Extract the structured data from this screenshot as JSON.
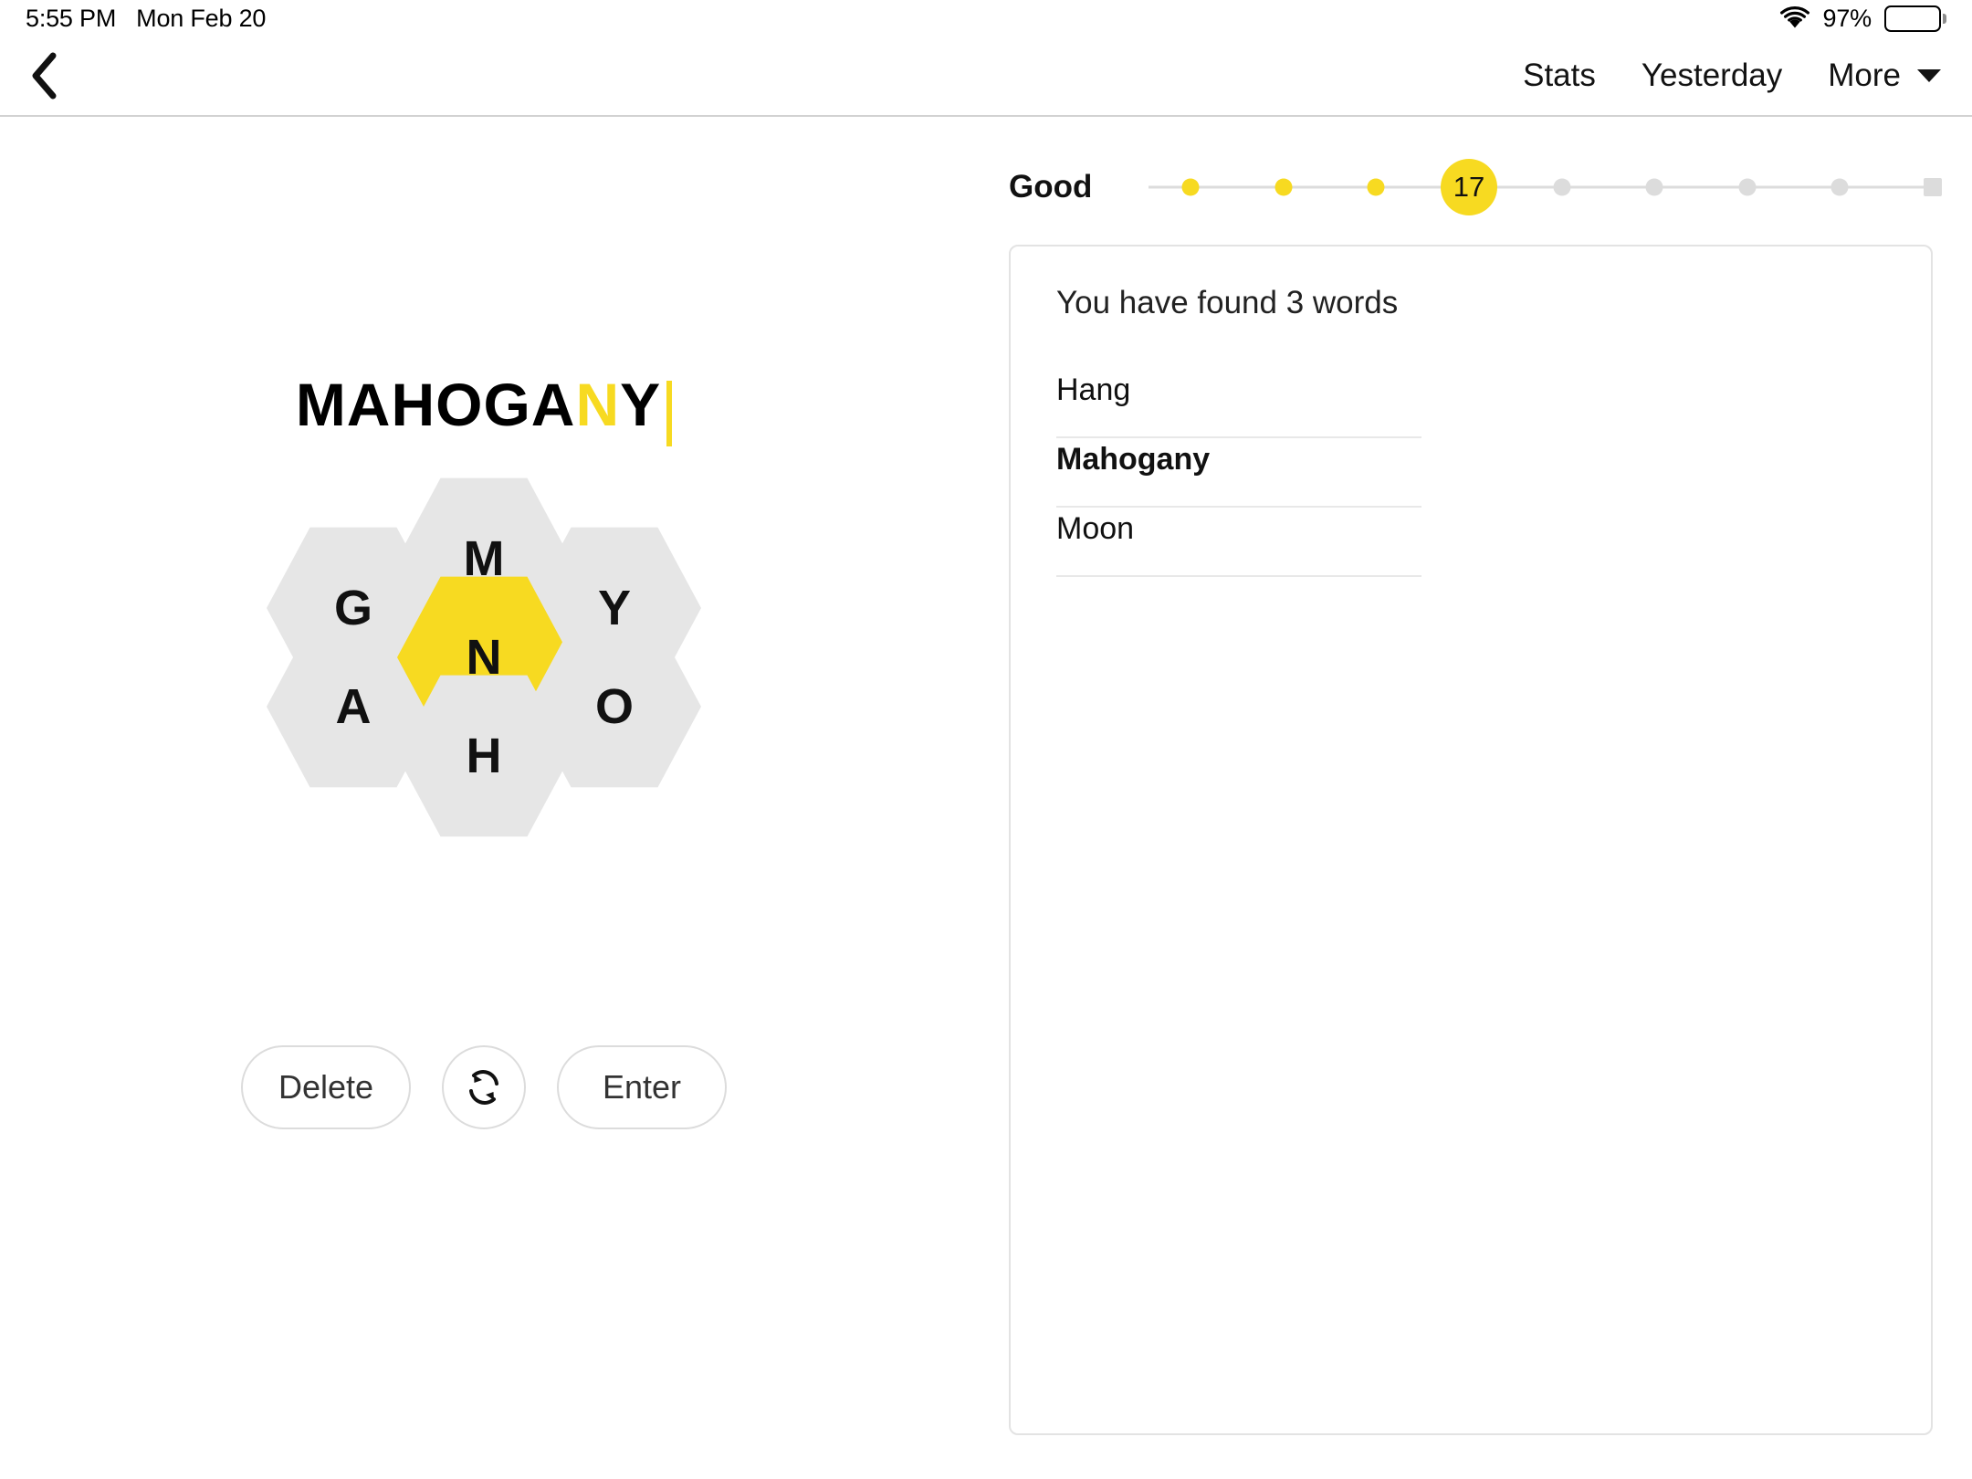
{
  "status_bar": {
    "time": "5:55 PM",
    "date": "Mon Feb 20",
    "battery_percent": "97%",
    "wifi_icon": "wifi-icon",
    "battery_icon": "battery-full-icon"
  },
  "nav": {
    "back_icon": "chevron-left-icon",
    "stats_label": "Stats",
    "yesterday_label": "Yesterday",
    "more_label": "More",
    "more_caret_icon": "chevron-down-icon"
  },
  "game": {
    "typed_word_prefix": "MAHOGA",
    "typed_word_center_letter": "N",
    "typed_word_suffix": "Y",
    "center_letter": "N",
    "outer_letters": [
      "M",
      "Y",
      "O",
      "H",
      "A",
      "G"
    ],
    "hive": {
      "center": "N",
      "top": "M",
      "top_right": "Y",
      "bottom_right": "O",
      "bottom": "H",
      "bottom_left": "A",
      "top_left": "G"
    },
    "colors": {
      "accent_yellow": "#f7da21",
      "hex_gray": "#e6e6e6",
      "border_gray": "#dcdcdc"
    }
  },
  "controls": {
    "delete_label": "Delete",
    "shuffle_icon": "shuffle-icon",
    "enter_label": "Enter"
  },
  "rank": {
    "label": "Good",
    "score": "17",
    "current_index": 3,
    "milestones": [
      {
        "state": "done"
      },
      {
        "state": "done"
      },
      {
        "state": "done"
      },
      {
        "state": "current",
        "value": "17"
      },
      {
        "state": "todo"
      },
      {
        "state": "todo"
      },
      {
        "state": "todo"
      },
      {
        "state": "todo"
      },
      {
        "state": "end"
      }
    ]
  },
  "words_panel": {
    "found_count_text": "You have found 3 words",
    "words": [
      {
        "text": "Hang",
        "pangram": false
      },
      {
        "text": "Mahogany",
        "pangram": true
      },
      {
        "text": "Moon",
        "pangram": false
      }
    ]
  }
}
